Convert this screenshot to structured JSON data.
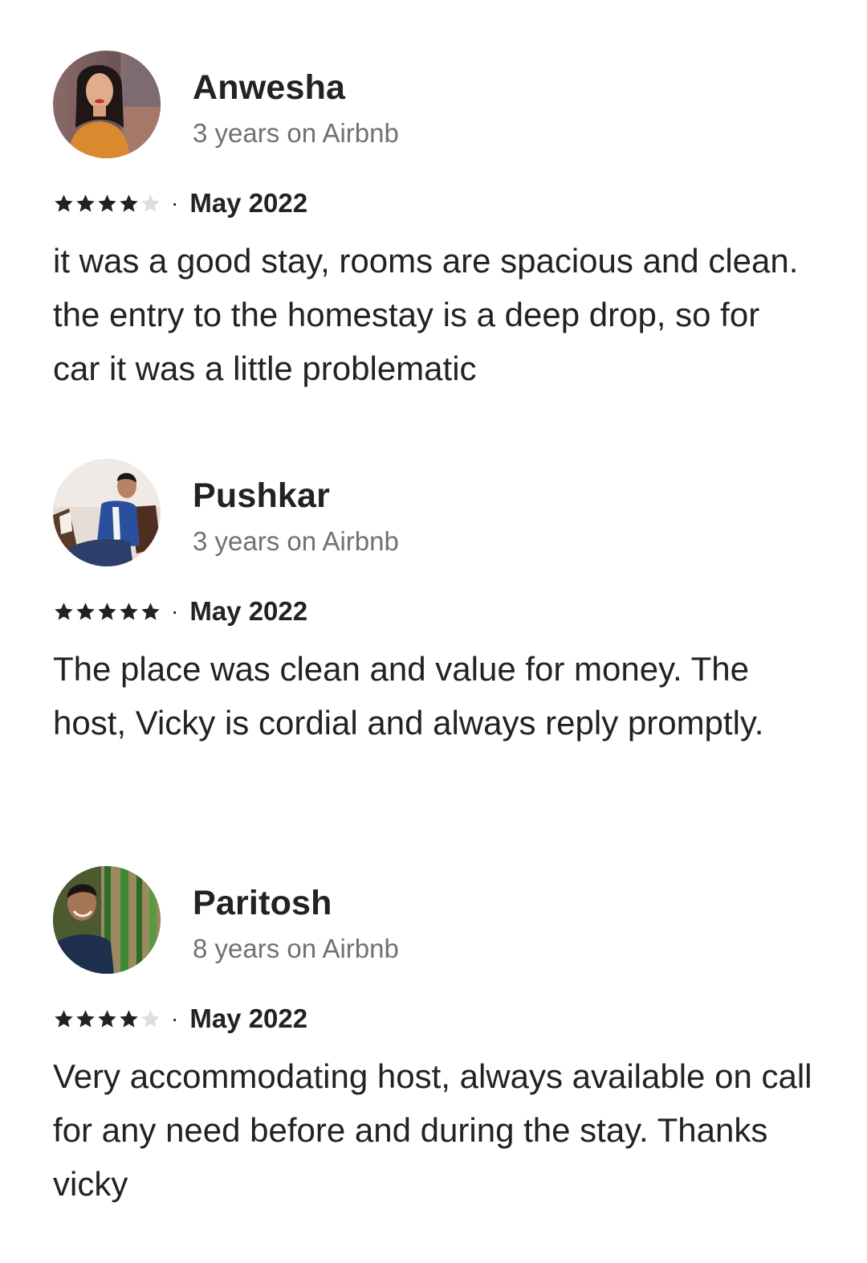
{
  "reviews": [
    {
      "name": "Anwesha",
      "tenure": "3 years on Airbnb",
      "rating": 4,
      "rating_max": 5,
      "separator": "·",
      "date": "May 2022",
      "text": "it was a good stay, rooms are spacious and clean. the entry to the homestay is a deep drop, so for car it was a little problematic"
    },
    {
      "name": "Pushkar",
      "tenure": "3 years on Airbnb",
      "rating": 5,
      "rating_max": 5,
      "separator": "·",
      "date": "May 2022",
      "text": "The place was clean and value for money. The host, Vicky is cordial and always reply promptly."
    },
    {
      "name": "Paritosh",
      "tenure": "8 years on Airbnb",
      "rating": 4,
      "rating_max": 5,
      "separator": "·",
      "date": "May 2022",
      "text": "Very accommodating host, always available on call for any need before and during the stay. Thanks vicky"
    }
  ],
  "colors": {
    "text_primary": "#222222",
    "text_secondary": "#717171",
    "star_filled": "#222222",
    "star_empty": "#dddddd",
    "background": "#ffffff"
  }
}
